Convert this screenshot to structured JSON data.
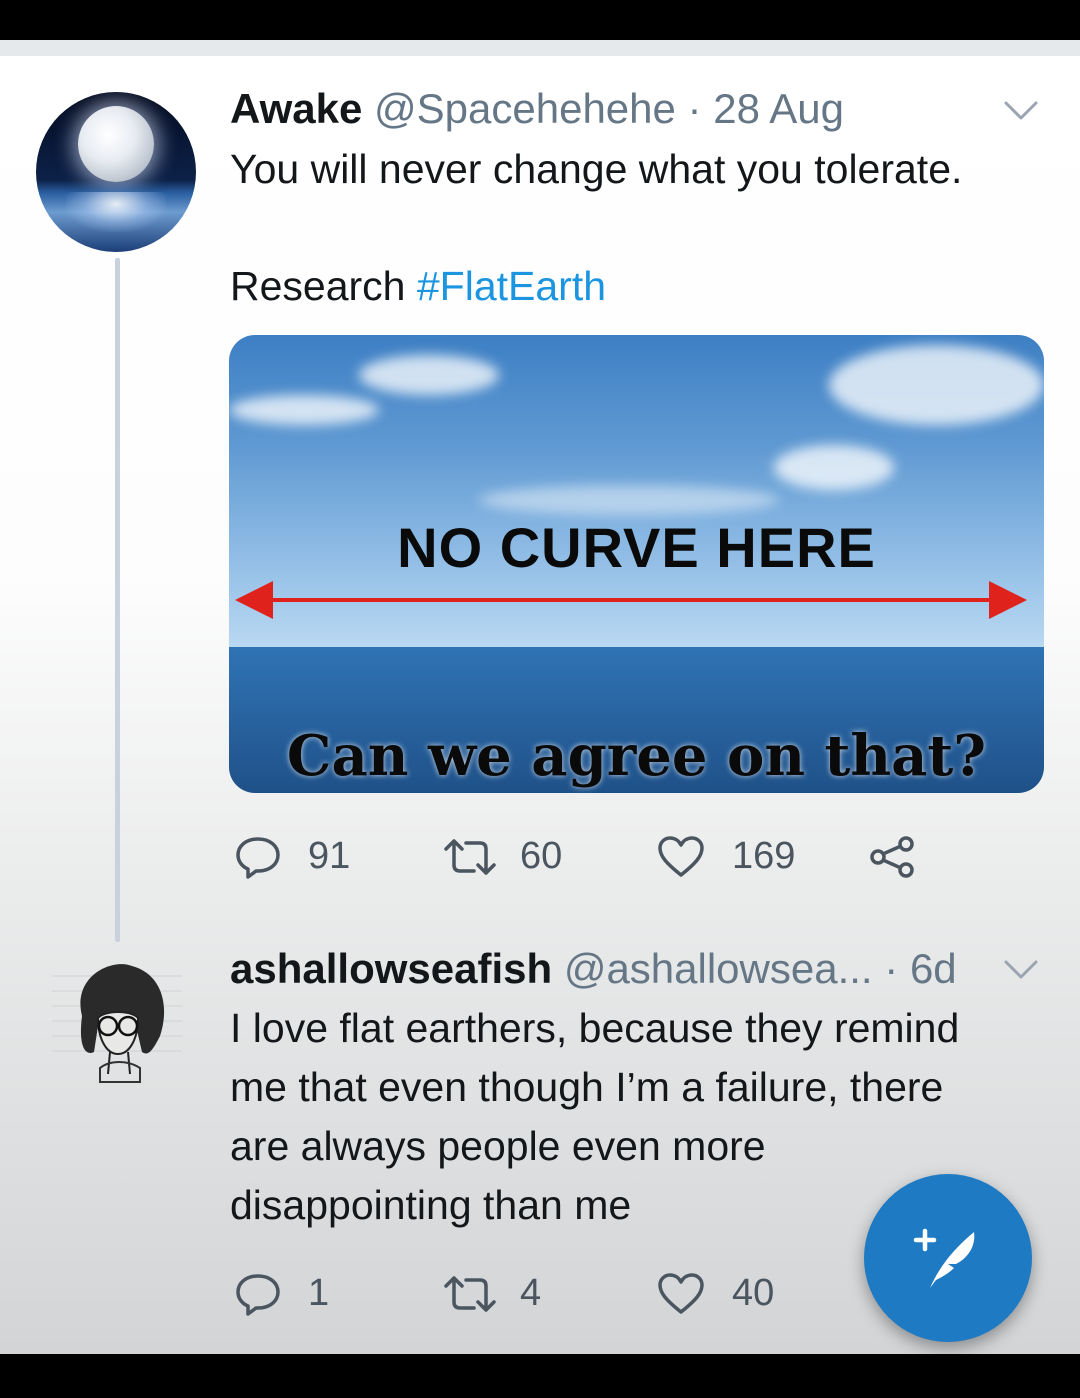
{
  "tweets": [
    {
      "name": "Awake",
      "handle": "@Spacehehehe",
      "time": "28 Aug",
      "text_line1": "You will never change what you tolerate.",
      "text_line2_prefix": "Research ",
      "hashtag": "#FlatEarth",
      "media": {
        "title": "NO CURVE HERE",
        "caption": "Can we agree on that?"
      },
      "replies": "91",
      "retweets": "60",
      "likes": "169"
    },
    {
      "name": "ashallowseafish",
      "handle": "@ashallowsea...",
      "time": "6d",
      "text_lines": [
        "I love flat earthers, because they remind",
        "me that even though I’m a failure, there",
        "are always people even more",
        "disappointing than me"
      ],
      "replies": "1",
      "retweets": "4",
      "likes": "40"
    }
  ],
  "icons": {
    "reply": "speech-bubble",
    "retweet": "retweet-arrows",
    "like": "heart",
    "share": "share-nodes",
    "more": "chevron-down",
    "compose": "plus-feather"
  },
  "colors": {
    "text": "#14171a",
    "meta": "#657786",
    "hashtag": "#1b95e0",
    "fab": "#1f7ac4",
    "arrow": "#e0221c"
  }
}
